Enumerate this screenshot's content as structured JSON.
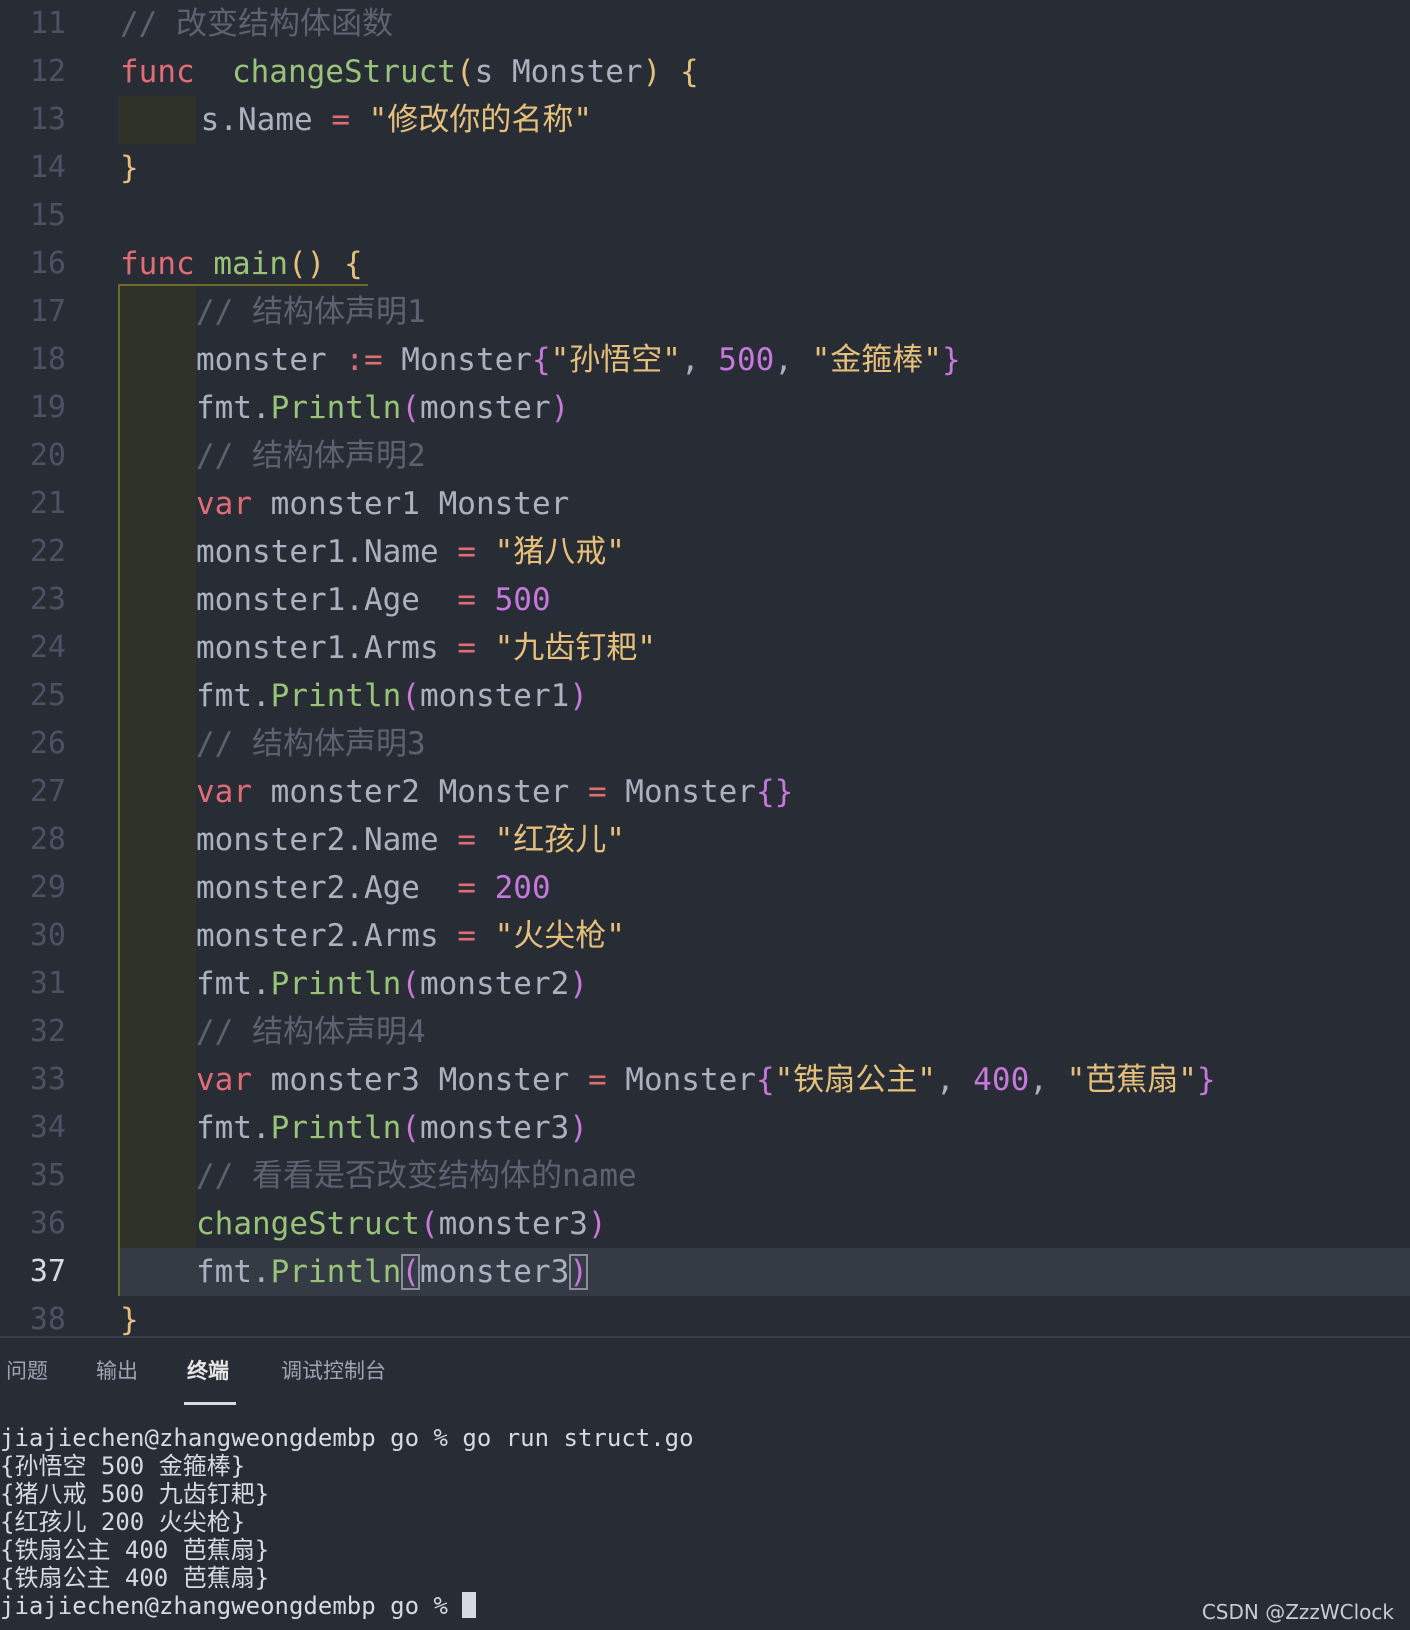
{
  "editor": {
    "active_line": "37",
    "line_numbers": [
      "11",
      "12",
      "13",
      "14",
      "15",
      "16",
      "17",
      "18",
      "19",
      "20",
      "21",
      "22",
      "23",
      "24",
      "25",
      "26",
      "27",
      "28",
      "29",
      "30",
      "31",
      "32",
      "33",
      "34",
      "35",
      "36",
      "37",
      "38"
    ],
    "lines": [
      [
        [
          "cm",
          "// 改变结构体函数"
        ]
      ],
      [
        [
          "kw",
          "func"
        ],
        [
          "",
          "  "
        ],
        [
          "fn",
          "changeStruct"
        ],
        [
          "bry",
          "("
        ],
        [
          "",
          "s Monster"
        ],
        [
          "bry",
          ")"
        ],
        [
          "",
          " "
        ],
        [
          "bry",
          "{"
        ]
      ],
      [
        [
          "",
          " s.Name "
        ],
        [
          "op",
          "="
        ],
        [
          "",
          " "
        ],
        [
          "str",
          "\"修改你的名称\""
        ]
      ],
      [
        [
          "bry",
          "}"
        ]
      ],
      [],
      [
        [
          "kw",
          "func"
        ],
        [
          "",
          " "
        ],
        [
          "fn",
          "main"
        ],
        [
          "bry",
          "()"
        ],
        [
          "",
          " "
        ],
        [
          "bry",
          "{"
        ]
      ],
      [
        [
          "",
          ""
        ],
        [
          "cm",
          "// 结构体声明1"
        ]
      ],
      [
        [
          "",
          "monster "
        ],
        [
          "op",
          ":="
        ],
        [
          "",
          " Monster"
        ],
        [
          "brp",
          "{"
        ],
        [
          "str",
          "\"孙悟空\""
        ],
        [
          "",
          ", "
        ],
        [
          "num",
          "500"
        ],
        [
          "",
          ", "
        ],
        [
          "str",
          "\"金箍棒\""
        ],
        [
          "brp",
          "}"
        ]
      ],
      [
        [
          "",
          "fmt."
        ],
        [
          "fn",
          "Println"
        ],
        [
          "brp",
          "("
        ],
        [
          "",
          "monster"
        ],
        [
          "brp",
          ")"
        ]
      ],
      [
        [
          "cm",
          "// 结构体声明2"
        ]
      ],
      [
        [
          "kw",
          "var"
        ],
        [
          "",
          " monster1 Monster"
        ]
      ],
      [
        [
          "",
          "monster1.Name "
        ],
        [
          "op",
          "="
        ],
        [
          "",
          " "
        ],
        [
          "str",
          "\"猪八戒\""
        ]
      ],
      [
        [
          "",
          "monster1.Age  "
        ],
        [
          "op",
          "="
        ],
        [
          "",
          " "
        ],
        [
          "num",
          "500"
        ]
      ],
      [
        [
          "",
          "monster1.Arms "
        ],
        [
          "op",
          "="
        ],
        [
          "",
          " "
        ],
        [
          "str",
          "\"九齿钉耙\""
        ]
      ],
      [
        [
          "",
          "fmt."
        ],
        [
          "fn",
          "Println"
        ],
        [
          "brp",
          "("
        ],
        [
          "",
          "monster1"
        ],
        [
          "brp",
          ")"
        ]
      ],
      [
        [
          "cm",
          "// 结构体声明3"
        ]
      ],
      [
        [
          "kw",
          "var"
        ],
        [
          "",
          " monster2 Monster "
        ],
        [
          "op",
          "="
        ],
        [
          "",
          " Monster"
        ],
        [
          "brp",
          "{}"
        ]
      ],
      [
        [
          "",
          "monster2.Name "
        ],
        [
          "op",
          "="
        ],
        [
          "",
          " "
        ],
        [
          "str",
          "\"红孩儿\""
        ]
      ],
      [
        [
          "",
          "monster2.Age  "
        ],
        [
          "op",
          "="
        ],
        [
          "",
          " "
        ],
        [
          "num",
          "200"
        ]
      ],
      [
        [
          "",
          "monster2.Arms "
        ],
        [
          "op",
          "="
        ],
        [
          "",
          " "
        ],
        [
          "str",
          "\"火尖枪\""
        ]
      ],
      [
        [
          "",
          "fmt."
        ],
        [
          "fn",
          "Println"
        ],
        [
          "brp",
          "("
        ],
        [
          "",
          "monster2"
        ],
        [
          "brp",
          ")"
        ]
      ],
      [
        [
          "cm",
          "// 结构体声明4"
        ]
      ],
      [
        [
          "kw",
          "var"
        ],
        [
          "",
          " monster3 Monster "
        ],
        [
          "op",
          "="
        ],
        [
          "",
          " Monster"
        ],
        [
          "brp",
          "{"
        ],
        [
          "str",
          "\"铁扇公主\""
        ],
        [
          "",
          ", "
        ],
        [
          "num",
          "400"
        ],
        [
          "",
          ", "
        ],
        [
          "str",
          "\"芭蕉扇\""
        ],
        [
          "brp",
          "}"
        ]
      ],
      [
        [
          "",
          "fmt."
        ],
        [
          "fn",
          "Println"
        ],
        [
          "brp",
          "("
        ],
        [
          "",
          "monster3"
        ],
        [
          "brp",
          ")"
        ]
      ],
      [
        [
          "cm",
          "// 看看是否改变结构体的name"
        ]
      ],
      [
        [
          "fn",
          "changeStruct"
        ],
        [
          "brp",
          "("
        ],
        [
          "",
          "monster3"
        ],
        [
          "brp",
          ")"
        ]
      ],
      [
        [
          "",
          "fmt."
        ],
        [
          "fn",
          "Println"
        ],
        [
          "brpm",
          "("
        ],
        [
          "",
          "monster3"
        ],
        [
          "brpm",
          ")"
        ]
      ],
      [
        [
          "bry",
          "}"
        ]
      ]
    ]
  },
  "panel": {
    "tabs": [
      "问题",
      "输出",
      "终端",
      "调试控制台"
    ],
    "active_tab": "终端"
  },
  "terminal": {
    "lines": [
      "jiajiechen@zhangweongdembp go % go run struct.go",
      "{孙悟空 500 金箍棒}",
      "{猪八戒 500 九齿钉耙}",
      "{红孩儿 200 火尖枪}",
      "{铁扇公主 400 芭蕉扇}",
      "{铁扇公主 400 芭蕉扇}",
      "jiajiechen@zhangweongdembp go % "
    ]
  },
  "watermark": "CSDN @ZzzWClock"
}
